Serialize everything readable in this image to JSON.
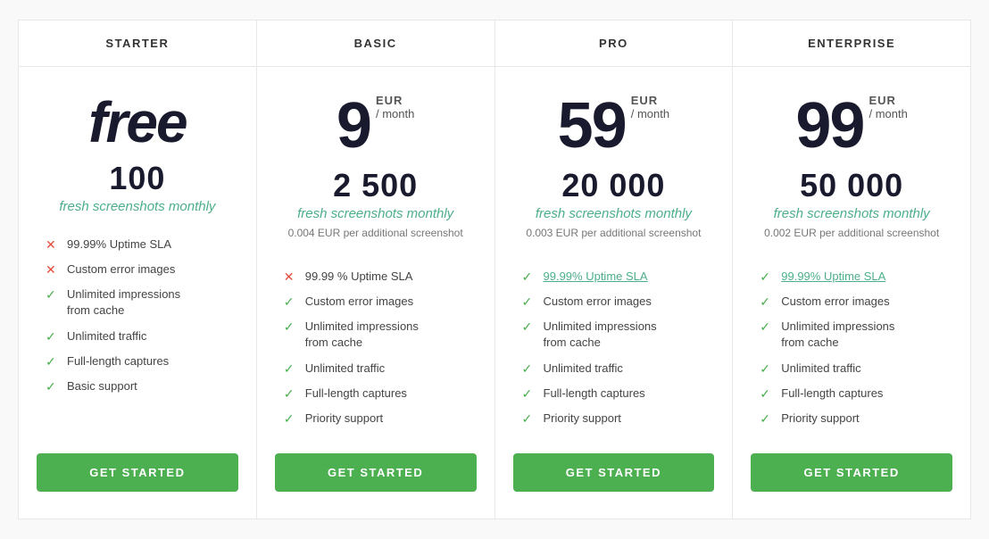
{
  "plans": [
    {
      "id": "starter",
      "header": "STARTER",
      "price_display": "free",
      "is_free": true,
      "currency": "",
      "period": "",
      "screenshots_count": "100",
      "screenshots_label": "fresh screenshots monthly",
      "extra_cost": "",
      "features": [
        {
          "icon": "cross",
          "text": "99.99% Uptime SLA",
          "link": false
        },
        {
          "icon": "cross",
          "text": "Custom error images",
          "link": false
        },
        {
          "icon": "check",
          "text_lines": [
            "Unlimited impressions",
            "from cache"
          ],
          "link": false
        },
        {
          "icon": "check",
          "text": "Unlimited traffic",
          "link": false
        },
        {
          "icon": "check",
          "text": "Full-length captures",
          "link": false
        },
        {
          "icon": "check",
          "text": "Basic support",
          "link": false
        }
      ],
      "button_label": "GET STARTED"
    },
    {
      "id": "basic",
      "header": "BASIC",
      "price_display": "9",
      "is_free": false,
      "currency": "EUR",
      "period": "/ month",
      "screenshots_count": "2 500",
      "screenshots_label": "fresh screenshots monthly",
      "extra_cost": "0.004 EUR per additional screenshot",
      "features": [
        {
          "icon": "cross",
          "text": "99.99 % Uptime SLA",
          "link": false
        },
        {
          "icon": "check",
          "text": "Custom error images",
          "link": false
        },
        {
          "icon": "check",
          "text_lines": [
            "Unlimited impressions",
            "from cache"
          ],
          "link": false
        },
        {
          "icon": "check",
          "text": "Unlimited traffic",
          "link": false
        },
        {
          "icon": "check",
          "text": "Full-length captures",
          "link": false
        },
        {
          "icon": "check",
          "text": "Priority support",
          "link": false
        }
      ],
      "button_label": "GET STARTED"
    },
    {
      "id": "pro",
      "header": "PRO",
      "price_display": "59",
      "is_free": false,
      "currency": "EUR",
      "period": "/ month",
      "screenshots_count": "20 000",
      "screenshots_label": "fresh screenshots monthly",
      "extra_cost": "0.003 EUR per additional screenshot",
      "features": [
        {
          "icon": "check",
          "text": "99.99% Uptime SLA",
          "link": true
        },
        {
          "icon": "check",
          "text": "Custom error images",
          "link": false
        },
        {
          "icon": "check",
          "text_lines": [
            "Unlimited impressions",
            "from cache"
          ],
          "link": false
        },
        {
          "icon": "check",
          "text": "Unlimited traffic",
          "link": false
        },
        {
          "icon": "check",
          "text": "Full-length captures",
          "link": false
        },
        {
          "icon": "check",
          "text": "Priority support",
          "link": false
        }
      ],
      "button_label": "GET STARTED"
    },
    {
      "id": "enterprise",
      "header": "ENTERPRISE",
      "price_display": "99",
      "is_free": false,
      "currency": "EUR",
      "period": "/ month",
      "screenshots_count": "50 000",
      "screenshots_label": "fresh screenshots monthly",
      "extra_cost": "0.002 EUR per additional screenshot",
      "features": [
        {
          "icon": "check",
          "text": "99.99% Uptime SLA",
          "link": true
        },
        {
          "icon": "check",
          "text": "Custom error images",
          "link": false
        },
        {
          "icon": "check",
          "text_lines": [
            "Unlimited impressions",
            "from cache"
          ],
          "link": false
        },
        {
          "icon": "check",
          "text": "Unlimited traffic",
          "link": false
        },
        {
          "icon": "check",
          "text": "Full-length captures",
          "link": false
        },
        {
          "icon": "check",
          "text": "Priority support",
          "link": false
        }
      ],
      "button_label": "GET STARTED"
    }
  ]
}
